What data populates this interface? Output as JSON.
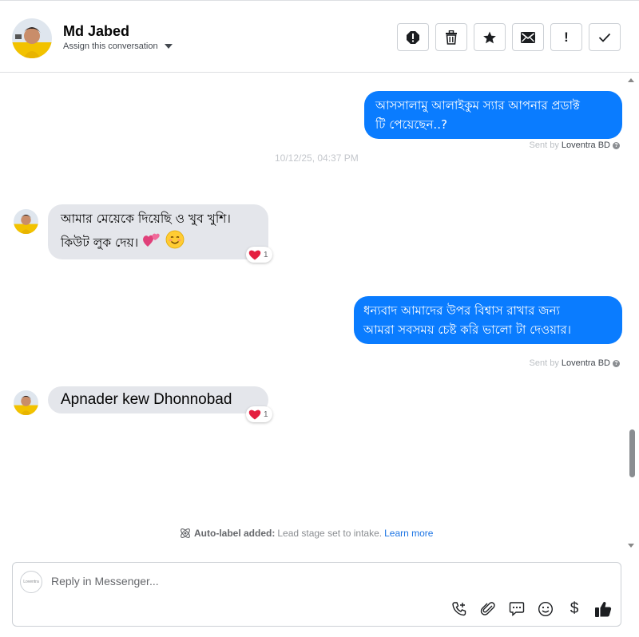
{
  "header": {
    "name": "Md Jabed",
    "assign_label": "Assign this conversation",
    "actions": [
      "report-icon",
      "trash-icon",
      "star-icon",
      "envelope-icon",
      "exclamation-icon",
      "check-icon"
    ],
    "exclamation_glyph": "!"
  },
  "messages": [
    {
      "direction": "outgoing",
      "line1": "আসসালামু আলাইকুম স্যার আপনার প্রডাক্ট",
      "line2": "টি পেয়েছেন..?",
      "sent_by_prefix": "Sent by",
      "sent_by": "Loventra BD"
    },
    {
      "timestamp": "10/12/25, 04:37 PM"
    },
    {
      "direction": "incoming",
      "line1": "আমার মেয়েকে দিয়েছি ও খুব খুশি।",
      "line2": "কিউট লুক দেয়।",
      "emojis": [
        "💕",
        "😊"
      ],
      "reaction": "❤",
      "reaction_count": "1"
    },
    {
      "direction": "outgoing",
      "line1": "ধন্যবাদ আমাদের উপর বিশ্বাস রাখার জন্য",
      "line2": "আমরা সবসময় চেষ্ট করি ভালো টা দেওয়ার।",
      "sent_by_prefix": "Sent by",
      "sent_by": "Loventra BD"
    },
    {
      "direction": "incoming",
      "text": "Apnader kew Dhonnobad",
      "reaction": "❤",
      "reaction_count": "1"
    }
  ],
  "auto_label": {
    "title": "Auto-label added:",
    "text": "Lead stage set to intake.",
    "link": "Learn more"
  },
  "composer": {
    "placeholder": "Reply in Messenger...",
    "avatar_text": "Loventra",
    "tools": [
      "call-add-icon",
      "paperclip-icon",
      "chat-bubble-icon",
      "smiley-icon",
      "dollar-icon",
      "thumbs-up-icon"
    ],
    "dollar_glyph": "$"
  },
  "colors": {
    "outgoing_bubble": "#0a7cff",
    "incoming_bubble": "#e4e6eb",
    "link": "#1b74e4",
    "heart": "#e41e3f"
  }
}
